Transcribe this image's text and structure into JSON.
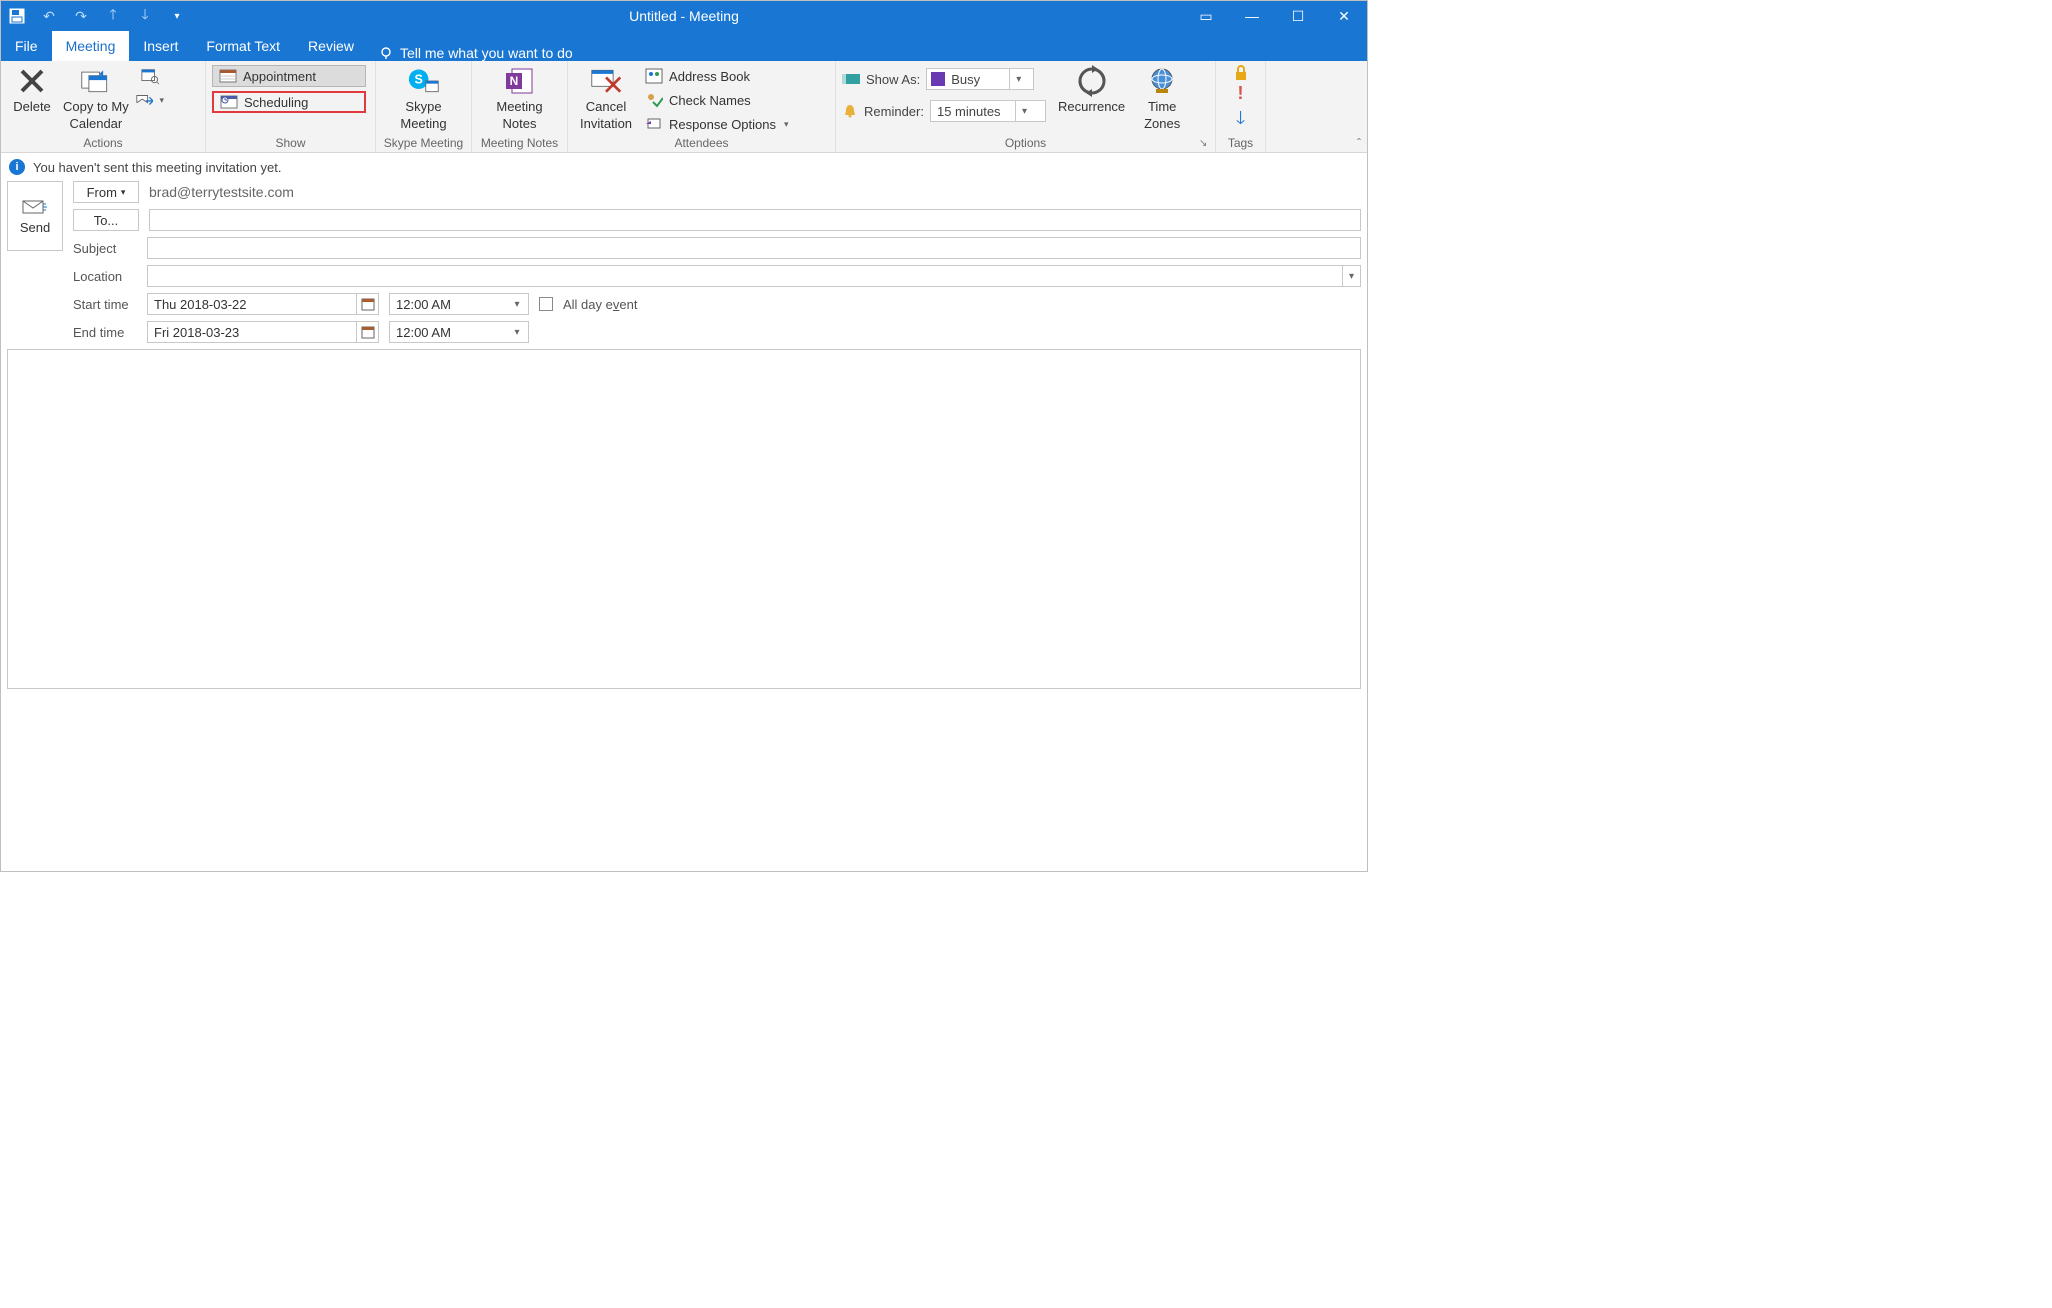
{
  "window": {
    "title": "Untitled  -  Meeting"
  },
  "tabs": {
    "file": "File",
    "meeting": "Meeting",
    "insert": "Insert",
    "format_text": "Format Text",
    "review": "Review",
    "tell_me": "Tell me what you want to do"
  },
  "ribbon": {
    "actions": {
      "label": "Actions",
      "delete": "Delete",
      "copy_to_my_calendar_l1": "Copy to My",
      "copy_to_my_calendar_l2": "Calendar"
    },
    "show": {
      "label": "Show",
      "appointment": "Appointment",
      "scheduling": "Scheduling"
    },
    "skype": {
      "label": "Skype Meeting",
      "btn_l1": "Skype",
      "btn_l2": "Meeting"
    },
    "meeting_notes": {
      "label": "Meeting Notes",
      "btn_l1": "Meeting",
      "btn_l2": "Notes"
    },
    "attendees": {
      "label": "Attendees",
      "cancel_l1": "Cancel",
      "cancel_l2": "Invitation",
      "address_book": "Address Book",
      "check_names": "Check Names",
      "response_options": "Response Options"
    },
    "options": {
      "label": "Options",
      "show_as_label": "Show As:",
      "show_as_value": "Busy",
      "reminder_label": "Reminder:",
      "reminder_value": "15 minutes",
      "recurrence": "Recurrence",
      "time_zones_l1": "Time",
      "time_zones_l2": "Zones"
    },
    "tags": {
      "label": "Tags"
    }
  },
  "info": {
    "text": "You haven't sent this meeting invitation yet."
  },
  "form": {
    "send": "Send",
    "from_btn": "From",
    "from_value": "brad@terrytestsite.com",
    "to_btn": "To...",
    "to_value": "",
    "subject_label": "Subject",
    "subject_value": "",
    "location_label": "Location",
    "location_value": "",
    "start_label": "Start time",
    "start_date": "Thu 2018-03-22",
    "start_time": "12:00 AM",
    "end_label": "End time",
    "end_date": "Fri 2018-03-23",
    "end_time": "12:00 AM",
    "all_day_label": "All day event"
  }
}
